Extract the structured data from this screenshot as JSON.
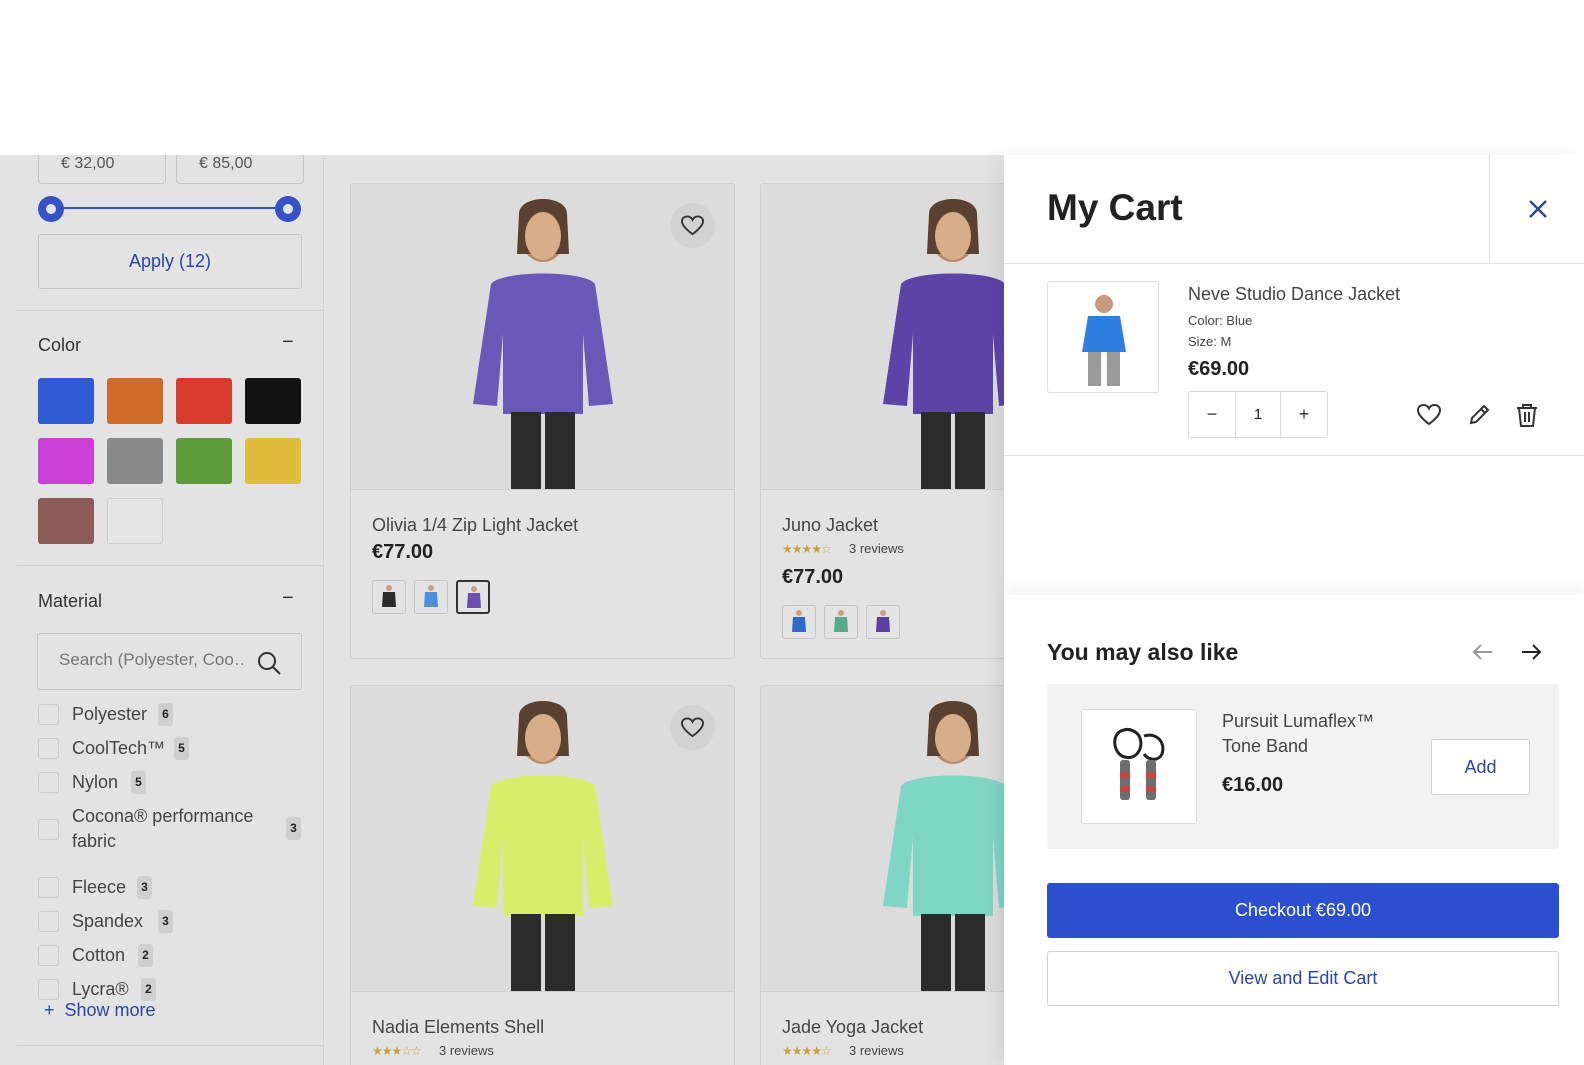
{
  "filters": {
    "price": {
      "min_label": "€ 32,00",
      "max_label": "€ 85,00"
    },
    "apply_label": "Apply (12)",
    "color": {
      "title": "Color",
      "toggle": "−",
      "swatches": [
        "#2f5ad3",
        "#cf6a2a",
        "#d83a2b",
        "#121212",
        "#cc3fd6",
        "#8a8a8a",
        "#5c9a3a",
        "#dfbd3d",
        "#8c5a57",
        "#e6e6e6"
      ]
    },
    "material": {
      "title": "Material",
      "toggle": "−",
      "search_placeholder": "Search (Polyester, Coo…",
      "items": [
        {
          "label": "Polyester",
          "count": "6"
        },
        {
          "label": "CoolTech™",
          "count": "5"
        },
        {
          "label": "Nylon",
          "count": "5"
        },
        {
          "label": "Cocona® performance fabric",
          "count": "3"
        },
        {
          "label": "Fleece",
          "count": "3"
        },
        {
          "label": "Spandex",
          "count": "3"
        },
        {
          "label": "Cotton",
          "count": "2"
        },
        {
          "label": "Lycra®",
          "count": "2"
        }
      ],
      "show_more_label": "Show more"
    }
  },
  "products": [
    {
      "name": "Olivia 1/4 Zip Light Jacket",
      "price": "€77.00",
      "reviews": "",
      "rating": 0,
      "image_color": "#6a58b8",
      "thumb_colors": [
        "#2a2a2a",
        "#4a8fd8",
        "#6a4fb0"
      ]
    },
    {
      "name": "Juno Jacket",
      "price": "€77.00",
      "reviews": "3 reviews",
      "rating": 4,
      "image_color": "#5b44a8",
      "thumb_colors": [
        "#2f69c9",
        "#5aa88a",
        "#5a3f9c"
      ]
    },
    {
      "name": "Nadia Elements Shell",
      "price": "",
      "reviews": "3 reviews",
      "rating": 3,
      "image_color": "#d8ee6a",
      "thumb_colors": []
    },
    {
      "name": "Jade Yoga Jacket",
      "price": "",
      "reviews": "3 reviews",
      "rating": 4,
      "image_color": "#7fd6c4",
      "thumb_colors": []
    }
  ],
  "cart": {
    "title": "My Cart",
    "item": {
      "name": "Neve Studio Dance Jacket",
      "color": "Color: Blue",
      "size": "Size: M",
      "price": "€69.00",
      "quantity": "1",
      "image_color": "#2e7fe0"
    },
    "recommendations": {
      "title": "You may also like",
      "product": {
        "name": "Pursuit Lumaflex™ Tone Band",
        "price": "€16.00",
        "add_label": "Add"
      }
    },
    "checkout_label": "Checkout  €69.00",
    "view_edit_label": "View and Edit Cart"
  },
  "colors": {
    "accent": "#2b4fcf",
    "link": "#2a45a8",
    "overlay_bg": "#e3e3e3"
  }
}
